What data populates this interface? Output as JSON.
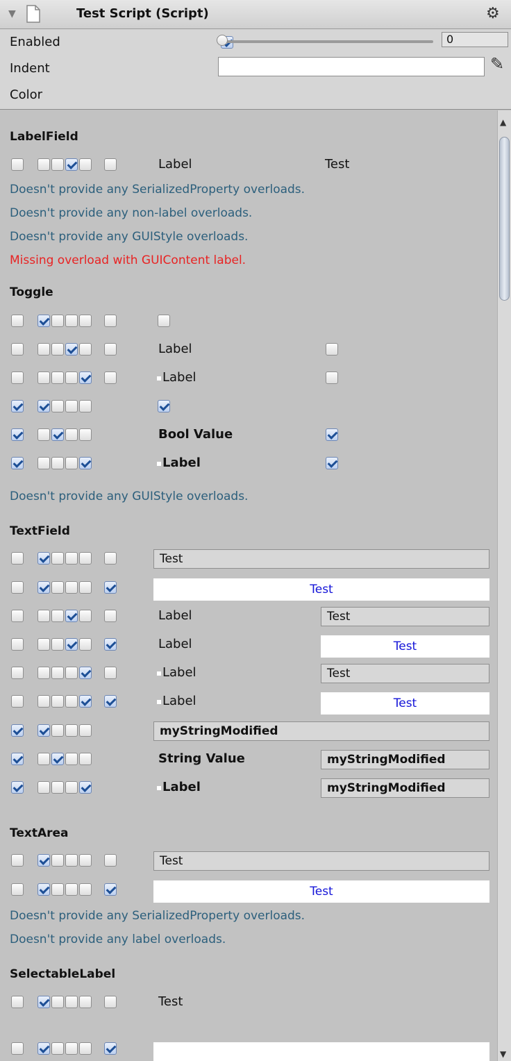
{
  "header": {
    "title": "Test Script (Script)"
  },
  "properties": {
    "enabled_label": "Enabled",
    "indent_label": "Indent",
    "indent_value": "0",
    "color_label": "Color"
  },
  "sections": {
    "labelfield": {
      "title": "LabelField",
      "row_label": "Label",
      "row_value": "Test",
      "info": [
        "Doesn't provide any SerializedProperty overloads.",
        "Doesn't provide any non-label overloads.",
        "Doesn't provide any GUIStyle overloads."
      ],
      "error": "Missing overload with GUIContent label."
    },
    "toggle": {
      "title": "Toggle",
      "label": "Label",
      "bool_value": "Bool Value",
      "info": "Doesn't provide any GUIStyle overloads."
    },
    "textfield": {
      "title": "TextField",
      "value": "Test",
      "label": "Label",
      "modified": "myStringModified",
      "string_value": "String Value"
    },
    "textarea": {
      "title": "TextArea",
      "value": "Test",
      "info": [
        "Doesn't provide any SerializedProperty overloads.",
        "Doesn't provide any label overloads."
      ]
    },
    "selectablelabel": {
      "title": "SelectableLabel",
      "value": "Test"
    }
  }
}
